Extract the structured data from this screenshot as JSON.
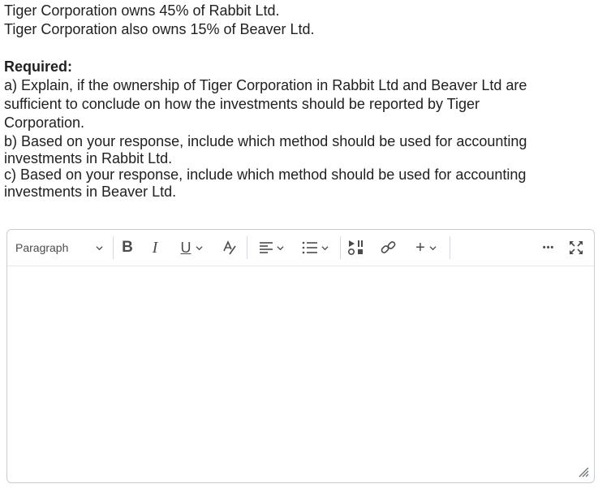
{
  "question": {
    "line1": "Tiger Corporation owns 45% of Rabbit Ltd.",
    "line2": "Tiger Corporation also owns 15% of Beaver Ltd.",
    "required_label": "Required:",
    "part_a_line1": "a) Explain, if the ownership of Tiger Corporation in Rabbit Ltd and Beaver Ltd are",
    "part_a_line2": "sufficient to conclude on how the investments should be reported by Tiger",
    "part_a_line3": "Corporation.",
    "part_b_line1": "b) Based on your response, include which method should be used for accounting",
    "part_b_line2": "investments in Rabbit Ltd.",
    "part_c_line1": "c) Based on your response, include which method should be used for accounting",
    "part_c_line2": "investments in Beaver Ltd."
  },
  "editor": {
    "paragraph_label": "Paragraph",
    "bold_label": "B",
    "italic_label": "I",
    "underline_label": "U",
    "insert_label": "+",
    "more_label": "•••",
    "content": ""
  },
  "colors": {
    "text": "#202122",
    "icon": "#494c4e",
    "border": "#c9ccd1"
  }
}
